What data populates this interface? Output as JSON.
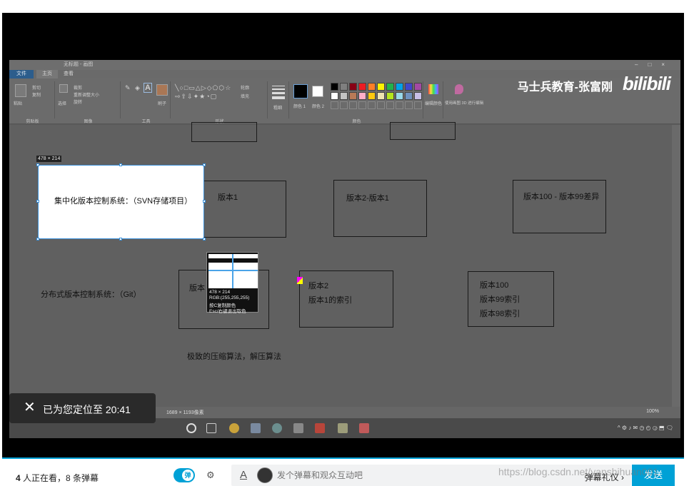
{
  "paint": {
    "window_title": "无标题 - 画图",
    "menu_tabs": [
      "文件",
      "主页",
      "查看"
    ],
    "ribbon_groups": [
      "剪贴板",
      "图像",
      "工具",
      "形状",
      "颜色"
    ],
    "ribbon_items": {
      "paste": "粘贴",
      "cut": "剪切",
      "copy": "复制",
      "select": "选择",
      "crop": "裁剪",
      "resize": "重新调整大小",
      "rotate": "旋转",
      "brush": "刷子",
      "outline": "轮廓",
      "fill": "填充",
      "size": "粗细",
      "color1": "颜色 1",
      "color2": "颜色 2",
      "edit_colors": "编辑颜色",
      "paint3d": "使用画图 3D 进行编辑"
    },
    "palette": [
      "#000000",
      "#7f7f7f",
      "#880015",
      "#ed1c24",
      "#ff7f27",
      "#fff200",
      "#22b14c",
      "#00a2e8",
      "#3f48cc",
      "#a349a4",
      "#ffffff",
      "#c3c3c3",
      "#b97a57",
      "#ffaec9",
      "#ffc90e",
      "#efe4b0",
      "#b5e61d",
      "#99d9ea",
      "#7092be",
      "#c8bfe7"
    ],
    "canvas": {
      "selection_size": "478 × 214",
      "centralized_label": "集中化版本控制系统：（SVN存储项目）",
      "distributed_label": "分布式版本控制系统：（Git）",
      "compression_label": "极致的压缩算法，解压算法",
      "boxes_row1": [
        "版本1",
        "版本2-版本1",
        "版本100 - 版本99差异"
      ],
      "box_row2_first": "版本",
      "box_row2_second": [
        "版本2",
        "版本1的索引"
      ],
      "box_row2_third": [
        "版本100",
        "版本99索引",
        "版本98索引"
      ]
    },
    "magnifier": {
      "size": "478 × 214",
      "rgb": "RGB:(255,255,255)",
      "hint1": "按C复制颜色",
      "hint2": "Esc/右键退出取色"
    },
    "status_size": "1689 × 1193像素"
  },
  "brand": {
    "teacher": "马士兵教育-张富刚",
    "logo": "bilibili"
  },
  "toast": {
    "text": "已为您定位至 20:41"
  },
  "bottom": {
    "viewers_count": "4",
    "viewers_text": " 人正在看，",
    "danmaku_count": "8",
    "danmaku_text": " 条弹幕",
    "toggle_label": "弹",
    "input_placeholder": "发个弹幕和观众互动吧",
    "etiquette": "弹幕礼仪 ›",
    "send": "发送",
    "watermark": "https://blog.csdn.net/yanshihuan001"
  },
  "colors": {
    "accent": "#00a1d6",
    "selection_border": "#3a8fd8"
  }
}
